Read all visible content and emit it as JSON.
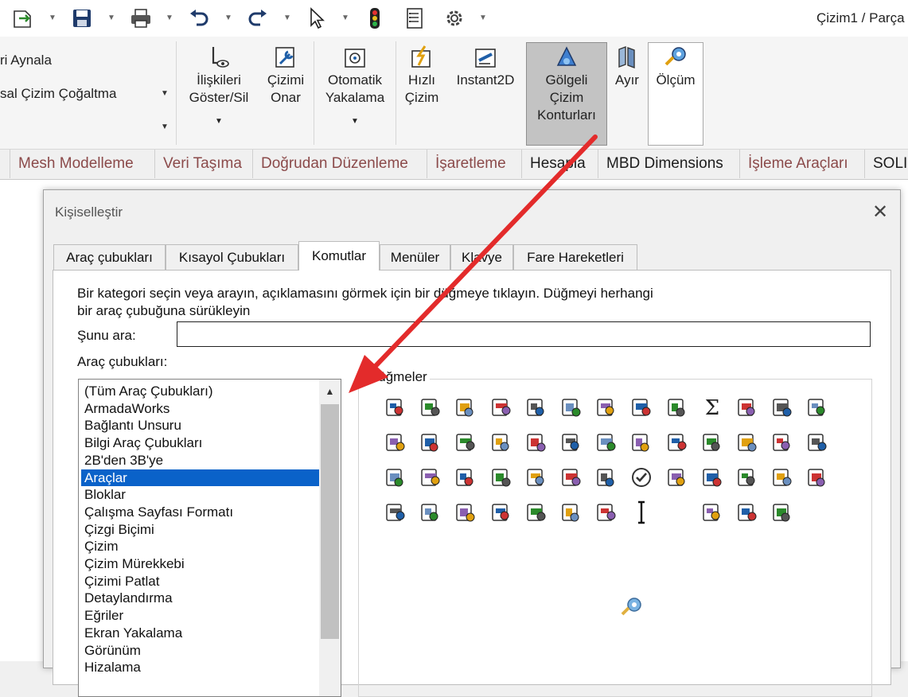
{
  "window": {
    "title": "Çizim1 / Parça"
  },
  "quick_access": {
    "icons": [
      "new-doc-icon",
      "save-icon",
      "print-icon",
      "undo-icon",
      "redo-icon",
      "select-icon",
      "traffic-light-icon",
      "file-properties-icon",
      "gear-icon"
    ]
  },
  "ribbon": {
    "left_items": [
      "ri Aynala",
      "sal Çizim Çoğaltma"
    ],
    "buttons": [
      {
        "id": "relations",
        "label": "İlişkileri\nGöster/Sil"
      },
      {
        "id": "repair",
        "label": "Çizimi\nOnar"
      },
      {
        "id": "autosnap",
        "label": "Otomatik\nYakalama"
      },
      {
        "id": "quicksketch",
        "label": "Hızlı\nÇizim"
      },
      {
        "id": "instant2d",
        "label": "Instant2D"
      },
      {
        "id": "shaded",
        "label": "Gölgeli\nÇizim\nKonturları"
      },
      {
        "id": "split",
        "label": "Ayır"
      },
      {
        "id": "measure",
        "label": "Ölçüm"
      }
    ]
  },
  "command_tabs": [
    "Mesh Modelleme",
    "Veri Taşıma",
    "Doğrudan Düzenleme",
    "İşaretleme",
    "Hesapla",
    "MBD Dimensions",
    "İşleme Araçları",
    "SOLID"
  ],
  "dialog": {
    "title": "Kişiselleştir",
    "close_glyph": "✕",
    "tabs": [
      "Araç çubukları",
      "Kısayol Çubukları",
      "Komutlar",
      "Menüler",
      "Klavye",
      "Fare Hareketleri"
    ],
    "active_tab": "Komutlar",
    "description_line1": "Bir kategori seçin veya arayın, açıklamasını görmek için bir düğmeye tıklayın. Düğmeyi herhangi",
    "description_line2": "bir araç çubuğuna sürükleyin",
    "search_label": "Şunu ara:",
    "search_value": "",
    "list_label": "Araç çubukları:",
    "buttons_label": "Düğmeler",
    "toolbar_categories": [
      "(Tüm Araç Çubukları)",
      "ArmadaWorks",
      "Bağlantı Unsuru",
      "Bilgi Araç Çubukları",
      "2B'den 3B'ye",
      "Araçlar",
      "Bloklar",
      "Çalışma Sayfası Formatı",
      "Çizgi Biçimi",
      "Çizim",
      "Çizim Mürekkebi",
      "Çizimi Patlat",
      "Detaylandırma",
      "Eğriler",
      "Ekran Yakalama",
      "Görünüm",
      "Hizalama"
    ],
    "selected_category": "Araçlar",
    "command_icons": [
      "spell-check-icon",
      "pen-tool-icon",
      "keys-icon",
      "measure-icon",
      "mass-properties-icon",
      "return-icon",
      "check-box-icon",
      "import-diagnostics-icon",
      "clock-icon",
      "sum-icon",
      "interference-icon",
      "parts-icon",
      "table-delete-icon",
      "doc-help-icon",
      "doc-list-icon",
      "parts-help-icon",
      "parts-question-icon",
      "check-geometry-icon",
      "compress-icon",
      "symmetry-icon",
      "find-replace-icon",
      "search-parts-icon",
      "database-icon",
      "brush-icon",
      "pointer-icon",
      "list-icon",
      "gear-check-icon",
      "doc-check-icon",
      "user-check-icon",
      "doc-settings-icon",
      "gauge-icon",
      "hands-icon",
      "rainbow-icon",
      "circle-check-icon",
      "color-squares-icon",
      "mesh-icon",
      "cylinders-icon",
      "cycle-icon",
      "components-icon",
      "box-hand-icon",
      "aec-icon",
      "target-icon",
      "gate-icon",
      "magnet-icon",
      "cloud-icon",
      "exit-block-icon",
      "cursor-beam-icon",
      "blank-icon",
      "pencil-icon",
      "mail-icon",
      "stamp-icon"
    ]
  },
  "colors": {
    "accent": "#0a62c9",
    "tab_text": "#8b4a4a",
    "arrow": "#e32b2b"
  }
}
